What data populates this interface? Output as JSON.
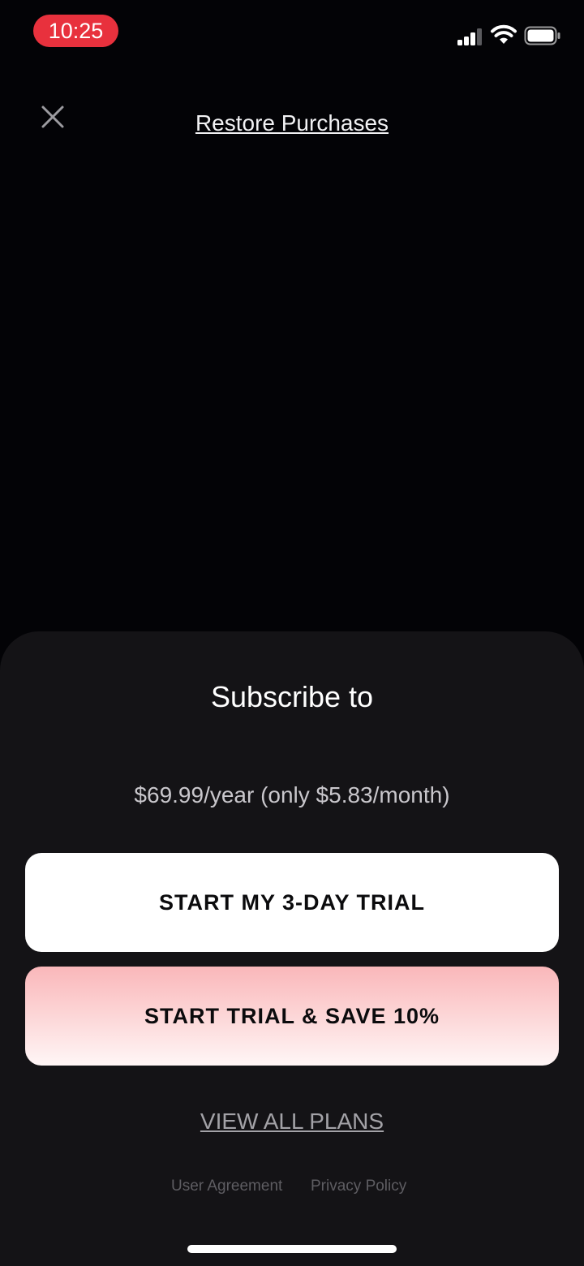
{
  "status_bar": {
    "time": "10:25",
    "icons": [
      "signal-icon",
      "wifi-icon",
      "battery-icon"
    ]
  },
  "header": {
    "close_icon": "close-icon",
    "restore_label": "Restore Purchases"
  },
  "sheet": {
    "title": "Subscribe to",
    "price": "$69.99/year (only $5.83/month)",
    "primary_button": "START MY 3-DAY TRIAL",
    "secondary_button": "START TRIAL & SAVE 10%",
    "view_all_plans": "VIEW ALL PLANS",
    "user_agreement": "User Agreement",
    "privacy_policy": "Privacy Policy"
  },
  "colors": {
    "time_pill": "#e8313d",
    "background": "#030306",
    "sheet": "#141316",
    "save_button_top": "#fab7ba",
    "save_button_bottom": "#fff6f6"
  }
}
